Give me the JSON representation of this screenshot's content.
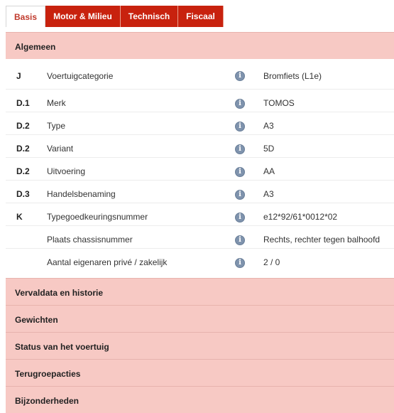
{
  "tabs": [
    {
      "label": "Basis"
    },
    {
      "label": "Motor & Milieu"
    },
    {
      "label": "Technisch"
    },
    {
      "label": "Fiscaal"
    }
  ],
  "general_section": {
    "title": "Algemeen"
  },
  "rows": [
    {
      "code": "J",
      "label": "Voertuigcategorie",
      "icon": "info-icon",
      "value": "Bromfiets (L1e)"
    },
    {
      "code": "D.1",
      "label": "Merk",
      "icon": "info-icon",
      "value": "TOMOS"
    },
    {
      "code": "D.2",
      "label": "Type",
      "icon": "info-icon",
      "value": "A3"
    },
    {
      "code": "D.2",
      "label": "Variant",
      "icon": "info-icon",
      "value": "5D"
    },
    {
      "code": "D.2",
      "label": "Uitvoering",
      "icon": "info-icon",
      "value": "AA"
    },
    {
      "code": "D.3",
      "label": "Handelsbenaming",
      "icon": "info-icon",
      "value": "A3"
    },
    {
      "code": "K",
      "label": "Typegoedkeuringsnummer",
      "icon": "info-icon",
      "value": "e12*92/61*0012*02"
    },
    {
      "code": "",
      "label": "Plaats chassisnummer",
      "icon": "info-icon",
      "value": "Rechts, rechter tegen balhoofd"
    },
    {
      "code": "",
      "label": "Aantal eigenaren privé / zakelijk",
      "icon": "info-icon",
      "value": "2 / 0"
    }
  ],
  "info_glyph": "i",
  "sections": [
    {
      "title": "Vervaldata en historie"
    },
    {
      "title": "Gewichten"
    },
    {
      "title": "Status van het voertuig"
    },
    {
      "title": "Terugroepacties"
    },
    {
      "title": "Bijzonderheden"
    }
  ],
  "colors": {
    "accent": "#c8220e",
    "section_bg": "#f7c9c4",
    "active_tab_text": "#c0392b",
    "info_icon": "#7f93ad"
  }
}
